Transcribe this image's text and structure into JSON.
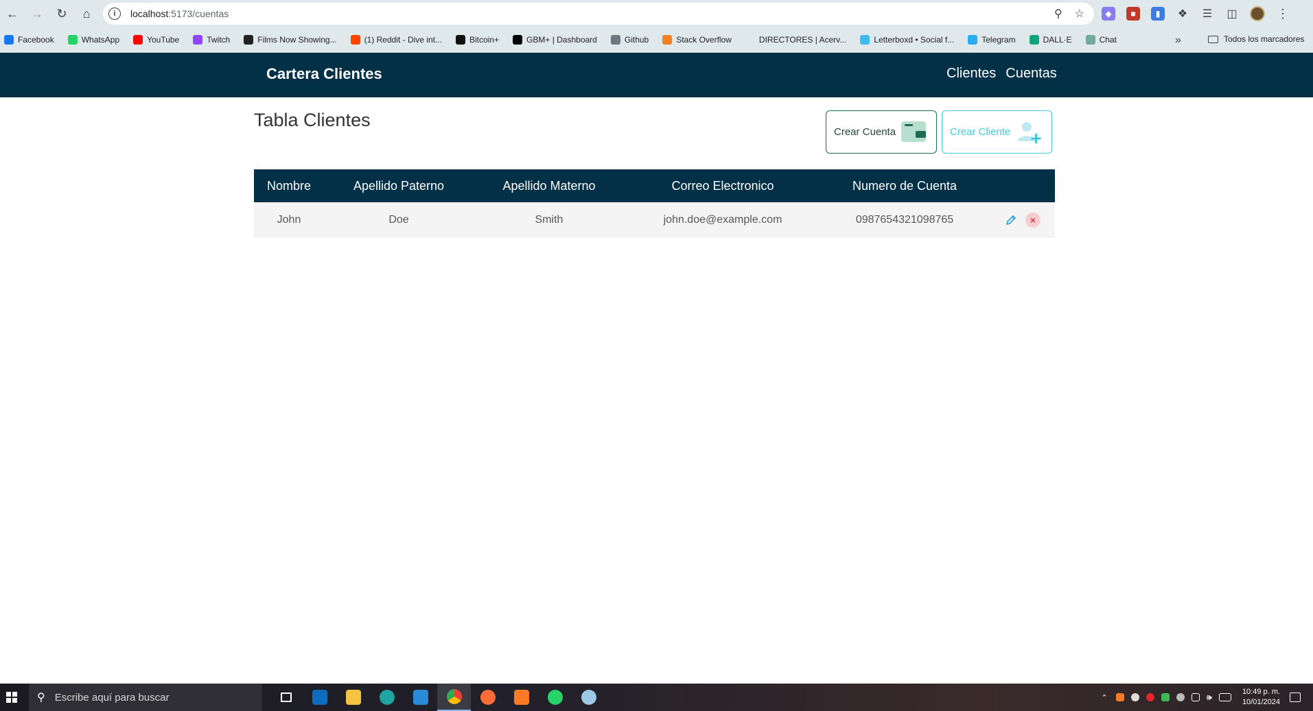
{
  "browser": {
    "url_host": "localhost",
    "url_path": ":5173/cuentas",
    "bookmarks": [
      {
        "label": "Facebook",
        "color": "#1877f2"
      },
      {
        "label": "WhatsApp",
        "color": "#25d366"
      },
      {
        "label": "YouTube",
        "color": "#ff0000"
      },
      {
        "label": "Twitch",
        "color": "#9146ff"
      },
      {
        "label": "Films Now Showing...",
        "color": "#222222"
      },
      {
        "label": "(1) Reddit - Dive int...",
        "color": "#ff4500"
      },
      {
        "label": "Bitcoin+",
        "color": "#111111"
      },
      {
        "label": "GBM+ | Dashboard",
        "color": "#000000"
      },
      {
        "label": "Github",
        "color": "#6e7681"
      },
      {
        "label": "Stack Overflow",
        "color": "#f48024"
      },
      {
        "label": "DIRECTORES | Acerv...",
        "color": "#dfe8ea"
      },
      {
        "label": "Letterboxd • Social f...",
        "color": "#40bcf4"
      },
      {
        "label": "Telegram",
        "color": "#2aabee"
      },
      {
        "label": "DALL·E",
        "color": "#10a37f"
      },
      {
        "label": "Chat",
        "color": "#74aa9c"
      }
    ],
    "all_bookmarks": "Todos los marcadores"
  },
  "app": {
    "brand": "Cartera Clientes",
    "nav": {
      "clientes": "Clientes",
      "cuentas": "Cuentas"
    },
    "page_title": "Tabla Clientes",
    "btn_crear_cuenta": "Crear Cuenta",
    "btn_crear_cliente": "Crear Cliente",
    "columns": [
      "Nombre",
      "Apellido Paterno",
      "Apellido Materno",
      "Correo Electronico",
      "Numero de Cuenta"
    ],
    "rows": [
      [
        "John",
        "Doe",
        "Smith",
        "john.doe@example.com",
        "0987654321098765"
      ]
    ],
    "colors": {
      "primary": "#023047",
      "accent_cyan": "#43c6d8",
      "accent_green": "#1d6b52",
      "danger": "#d63d4c"
    }
  },
  "taskbar": {
    "search_placeholder": "Escribe aquí para buscar",
    "time": "10:49 p. m.",
    "date": "10/01/2024"
  }
}
